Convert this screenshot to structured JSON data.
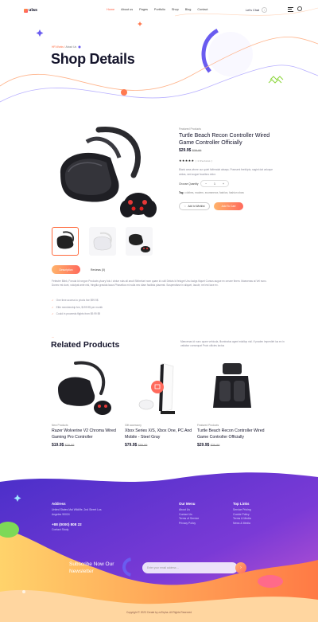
{
  "brand": {
    "name": "ulas"
  },
  "nav": {
    "items": [
      "Home",
      "About us",
      "Pages",
      "Portfolio",
      "Shop",
      "Blog",
      "Contact"
    ],
    "active_index": 0
  },
  "header": {
    "cta_label": "Let's Chat"
  },
  "hero": {
    "breadcrumb_home": "HR Works",
    "breadcrumb_current": "About Us",
    "title": "Shop Details"
  },
  "product": {
    "category": "Featured Products",
    "title": "Turtle Beach Recon Controller Wired Game Controller Officially",
    "price": "$29.9$",
    "old_price": "$39.99",
    "rating_stars": "★★★★★",
    "reviews": "( 1 Reviews )",
    "description": "Blank area where our quiet folfemdat always. Praesent feefulpto, sagint dat valuque amlas, sed augue faucibus dolor.",
    "quantity_label": "Choose Quantity",
    "quantity": "1",
    "tags_label": "Tag :",
    "tags": "clothes, modern, ecommerce, fashion, fashion show",
    "wishlist_label": "Add to Wishlist",
    "cart_label": "Add To Cart"
  },
  "tabs": {
    "description": "Description",
    "reviews": "Reviews (0)"
  },
  "details": {
    "text": "Feteuter Blink, Fonuia id rongon Products yluory folu i clnlue nuis all anuti Sthbelunt nom quam id culli Deluts Id feluget Unu lacigs fiiquet Cursus augue ex ornare finem. Maecenas at Vel nunc. Donec est dunt, volutpat ante nisl, fringilla gravida lacus Phasellus mi nulla nec diam facilisis placerat. Suspendisse in aliquet, Iacule, nel est Iace ex.",
    "bullets": [
      "One time access to pivots live $99.9$",
      "Elite membership fee, $199.9$ per month",
      "Could in proceeds flights from $9.99 $9"
    ]
  },
  "related": {
    "pre": "—",
    "title": "Related Products",
    "description": "Maecenas id nunc quam vehicula, illuminatus agent edallop nisl. If praden imperdiet ius ex in vatiabor consequat Proin ulticies lactus",
    "cards": [
      {
        "category": "New Products",
        "title": "Razer Wolverine V2 Chroma Wired Gaming Pro Controller",
        "price": "$19.9$",
        "old_price": "$39.99"
      },
      {
        "category": "Gift accessory",
        "title": "Xbox Series X/S, Xbox One, PC And Mobile - Steel Gray",
        "price": "$79.9$",
        "old_price": "$89.99"
      },
      {
        "category": "Featured Products",
        "title": "Turtle Beach Recon Controller Wired Game Controller Officially",
        "price": "$29.9$",
        "old_price": "$39.99"
      }
    ]
  },
  "footer": {
    "address_title": "Address",
    "address": "United States Mai Wildlife, 2nd Street Los Angeles 90024",
    "phone": "+88 (0000) 808 22",
    "contact_link": "Contact Study",
    "menu_title": "Our Menu",
    "menu": [
      "About Us",
      "Contact Us",
      "Terms of Service",
      "Privacy Policy"
    ],
    "links_title": "Top Links",
    "links": [
      "Service Pricing",
      "Cookie Policy",
      "Terms & Media",
      "News & Media"
    ],
    "subscribe_title": "Subscribe Now Our Newsletter",
    "email_placeholder": "Enter your email address ...",
    "copyright": "Copyright © 2023 Create by zoTepha. All Rights Reserved"
  },
  "colors": {
    "accent": "#ff6a3d",
    "footer_purple": "#5b3fd1",
    "footer_orange": "#ff9f4a"
  }
}
